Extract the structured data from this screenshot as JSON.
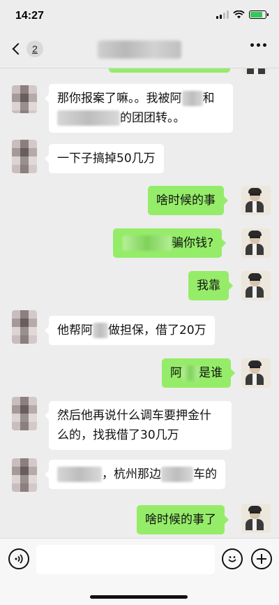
{
  "status_bar": {
    "time": "14:27"
  },
  "nav": {
    "unread_count": "2"
  },
  "messages": [
    {
      "side": "left",
      "parts": [
        "那你报案了嘛。。我被阿",
        "和"
      ],
      "line2": [
        "",
        "的团团转。。"
      ]
    },
    {
      "side": "left",
      "text": "一下子搞掉50几万"
    },
    {
      "side": "right",
      "text": "啥时候的事"
    },
    {
      "side": "right",
      "text": "骗你钱?"
    },
    {
      "side": "right",
      "text": "我靠"
    },
    {
      "side": "left",
      "parts": [
        "他帮阿",
        "做担保，借了20万"
      ]
    },
    {
      "side": "right",
      "parts": [
        "阿",
        "是谁"
      ]
    },
    {
      "side": "left",
      "line1": "然后他再说什么调车要押金什",
      "line2": "么的，找我借了30几万"
    },
    {
      "side": "left",
      "parts": [
        "，杭州那边",
        "车的"
      ]
    },
    {
      "side": "right",
      "text": "啥时候的事了"
    }
  ],
  "input_bar": {
    "voice_icon": "voice-icon",
    "emoji_icon": "emoji-icon",
    "add_icon": "plus-icon"
  }
}
